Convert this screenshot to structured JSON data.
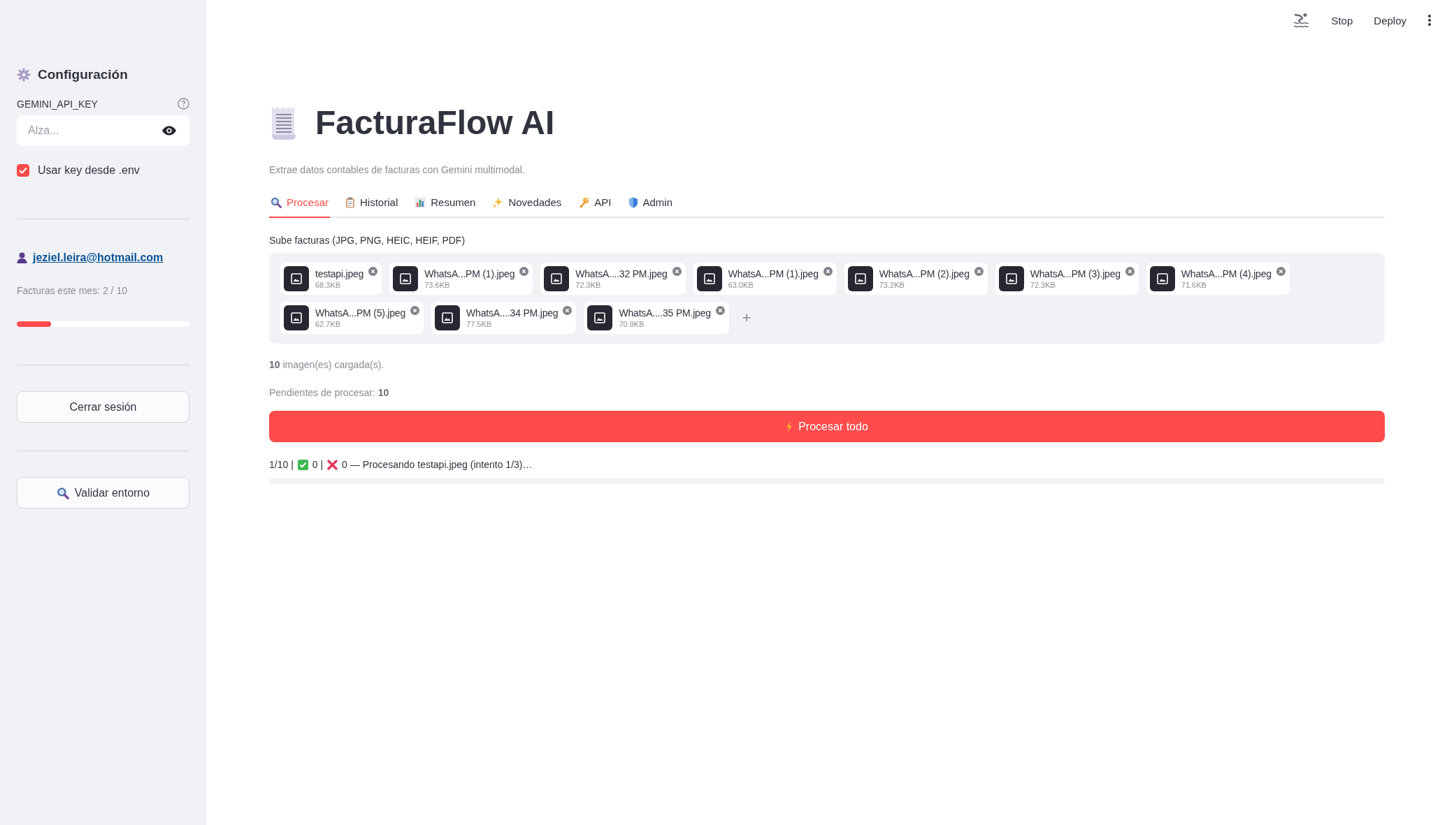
{
  "toolbar": {
    "stop": "Stop",
    "deploy": "Deploy"
  },
  "sidebar": {
    "title": "Configuración",
    "api_key": {
      "label": "GEMINI_API_KEY",
      "placeholder": "Alza..."
    },
    "use_env": {
      "label": "Usar key desde .env",
      "checked": true
    },
    "user_email": "jeziel.leira@hotmail.com",
    "usage": {
      "label": "Facturas este mes: 2 / 10",
      "level": 0.2
    },
    "logout_button": "Cerrar sesión",
    "validate_button": "Validar entorno"
  },
  "main": {
    "title": "FacturaFlow AI",
    "subtitle": "Extrae datos contables de facturas con Gemini multimodal.",
    "tabs": [
      {
        "label": "Procesar",
        "selected": true
      },
      {
        "label": "Historial",
        "selected": false
      },
      {
        "label": "Resumen",
        "selected": false
      },
      {
        "label": "Novedades",
        "selected": false
      },
      {
        "label": "API",
        "selected": false
      },
      {
        "label": "Admin",
        "selected": false
      }
    ],
    "uploader": {
      "label": "Sube facturas (JPG, PNG, HEIC, HEIF, PDF)",
      "files": [
        {
          "name": "testapi.jpeg",
          "size": "68.3KB"
        },
        {
          "name": "WhatsA...PM (1).jpeg",
          "size": "73.6KB"
        },
        {
          "name": "WhatsA....32 PM.jpeg",
          "size": "72.3KB"
        },
        {
          "name": "WhatsA...PM (1).jpeg",
          "size": "63.0KB"
        },
        {
          "name": "WhatsA...PM (2).jpeg",
          "size": "73.2KB"
        },
        {
          "name": "WhatsA...PM (3).jpeg",
          "size": "72.3KB"
        },
        {
          "name": "WhatsA...PM (4).jpeg",
          "size": "71.6KB"
        },
        {
          "name": "WhatsA...PM (5).jpeg",
          "size": "62.7KB"
        },
        {
          "name": "WhatsA....34 PM.jpeg",
          "size": "77.5KB"
        },
        {
          "name": "WhatsA....35 PM.jpeg",
          "size": "70.9KB"
        }
      ],
      "add": "+"
    },
    "loaded_text": "**10** imagen(es) cargada(s).",
    "pending_text": "Pendientes de procesar: **10**",
    "process_button": "Procesar todo",
    "status": {
      "progress": "1/10 |",
      "ok": "0 |",
      "failed": "0 — Procesando testapi.jpeg (intento 1/3)…"
    }
  }
}
